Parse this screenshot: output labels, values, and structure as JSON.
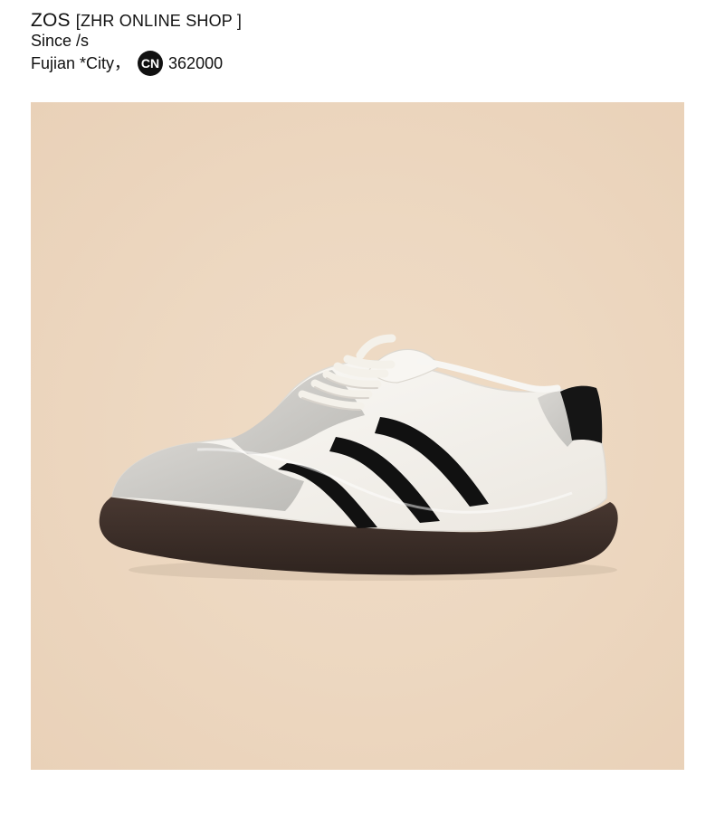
{
  "header": {
    "brand": "ZOS",
    "shop": "[ZHR ONLINE SHOP ]",
    "since": "Since /s",
    "location": "Fujian *City，",
    "country_code": "CN",
    "postal_code": "362000"
  },
  "photo": {
    "subject": "sneaker",
    "background_color": "#edd8c1",
    "colors": {
      "upper": "#f7f5f1",
      "suede": "#c8c7c4",
      "stripe": "#111111",
      "sole": "#3e2f29",
      "laces": "#f4f1ea"
    }
  }
}
